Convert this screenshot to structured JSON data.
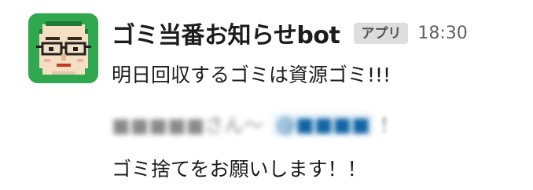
{
  "message": {
    "sender": "ゴミ当番お知らせbot",
    "badge": "アプリ",
    "time": "18:30",
    "line1": "明日回収するゴミは資源ゴミ!!!",
    "line2_blurred_name": "■■■■■さん〜",
    "line2_blurred_mention": "@■■■■",
    "line2_tail": "！",
    "line3": "ゴミ捨てをお願いします！！"
  },
  "icons": {
    "avatar": "pixel-art-face-with-glasses-icon"
  },
  "colors": {
    "avatar_bg": "#2fa84f",
    "text": "#1d1c1d",
    "muted": "#616061",
    "badge_bg": "#dddddd",
    "mention": "#1264a3"
  }
}
